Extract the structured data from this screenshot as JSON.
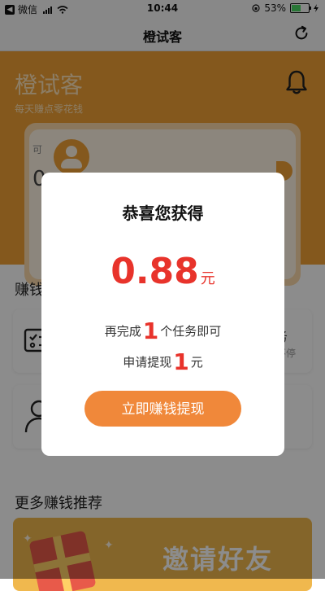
{
  "status_bar": {
    "app_back": "微信",
    "time": "10:44",
    "battery_percent": "53%",
    "battery_level": 0.53
  },
  "nav": {
    "title": "橙试客",
    "refresh_icon": "refresh-icon"
  },
  "header": {
    "brand_title": "橙试客",
    "brand_subtitle": "每天赚点零花钱",
    "bell_icon": "bell-icon",
    "card_partial_label": "可",
    "card_partial_value": "0"
  },
  "content": {
    "section_title": "赚钱",
    "task_partial_title": "务",
    "task_partial_sub": "不停",
    "more_title": "更多赚钱推荐",
    "invite_text": "邀请好友"
  },
  "modal": {
    "title": "恭喜您获得",
    "amount": "0.88",
    "amount_unit": "元",
    "line1_prefix": "再完成",
    "line1_num": "1",
    "line1_suffix": "个任务即可",
    "line2_prefix": "申请提现",
    "line2_num": "1",
    "line2_suffix": "元",
    "button_label": "立即赚钱提现"
  },
  "colors": {
    "brand_orange": "#f0a035",
    "accent_red": "#e8332b",
    "button_orange": "#f0883a"
  }
}
